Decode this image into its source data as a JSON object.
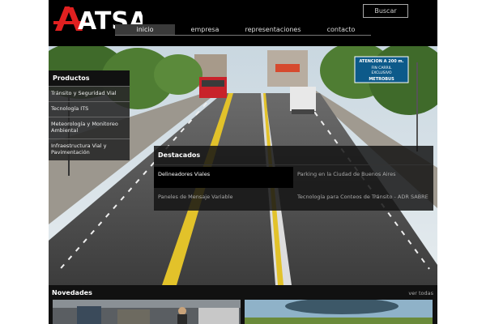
{
  "header": {
    "logo_text": "ATSA",
    "search_label": "Buscar"
  },
  "nav": {
    "items": [
      {
        "label": "inicio",
        "active": true
      },
      {
        "label": "empresa",
        "active": false
      },
      {
        "label": "representaciones",
        "active": false
      },
      {
        "label": "contacto",
        "active": false
      }
    ]
  },
  "hero": {
    "bus_sign": {
      "line1": "ATENCION A 200 m.",
      "line2": "FIN CARRIL",
      "line3": "EXCLUSIVO",
      "line4": "METROBUS"
    }
  },
  "sidebar": {
    "title": "Productos",
    "items": [
      {
        "label": "Tránsito y Seguridad Vial"
      },
      {
        "label": "Tecnología ITS"
      },
      {
        "label": "Meteorología y Monitoreo Ambiental"
      },
      {
        "label": "Infraestructura Vial y Pavimentación"
      }
    ]
  },
  "featured": {
    "title": "Destacados",
    "items": [
      {
        "label": "Delineadores Viales",
        "active": true
      },
      {
        "label": "Parking en la Ciudad de Buenos Aires",
        "active": false
      },
      {
        "label": "Paneles de Mensaje Variable",
        "active": false
      },
      {
        "label": "Tecnología para Conteos de Tránsito - ADR SABRE",
        "active": false
      }
    ]
  },
  "news": {
    "title": "Novedades",
    "more_label": "ver todas"
  },
  "colors": {
    "background": "#000000",
    "accent_red": "#e02020",
    "sign_blue": "#0d5a8a"
  }
}
